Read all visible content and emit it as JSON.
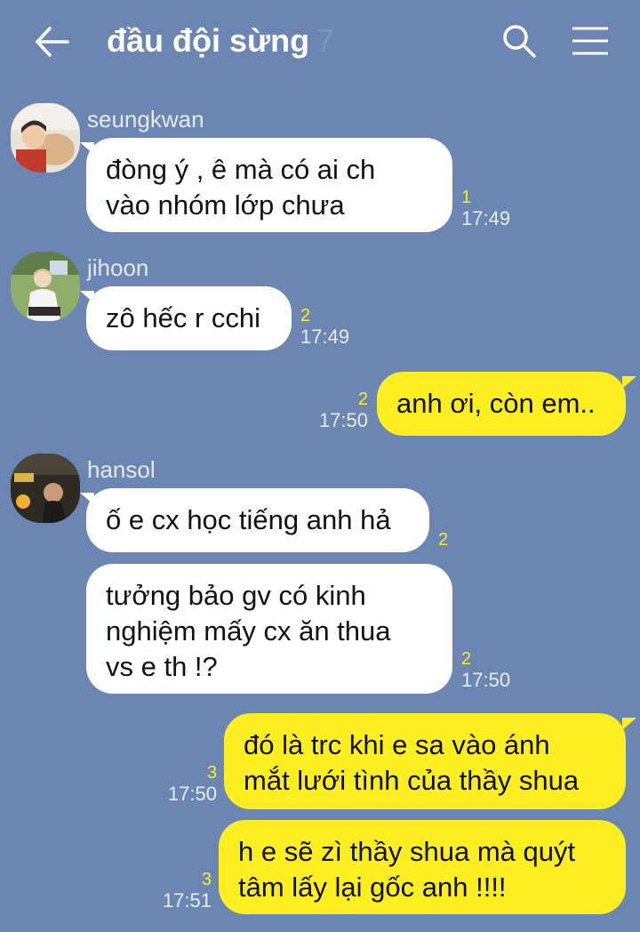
{
  "header": {
    "title": "đầu đội sừng",
    "member_count": "7",
    "back_icon": "back-arrow-icon",
    "search_icon": "search-icon",
    "menu_icon": "menu-icon"
  },
  "colors": {
    "background": "#6c86b3",
    "incoming_bubble": "#ffffff",
    "outgoing_bubble": "#fcee21",
    "unread_count": "#fcee21"
  },
  "messages": [
    {
      "sender": "seungkwan",
      "direction": "incoming",
      "text": "đòng ý , ê mà có ai ch\nvào nhóm lớp chưa",
      "unread": "1",
      "time": "17:49"
    },
    {
      "sender": "jihoon",
      "direction": "incoming",
      "text": "zô hếc r cchi",
      "unread": "2",
      "time": "17:49"
    },
    {
      "sender": "",
      "direction": "outgoing",
      "text": "anh ơi, còn em..",
      "unread": "2",
      "time": "17:50"
    },
    {
      "sender": "hansol",
      "direction": "incoming",
      "text": "ố e cx học tiếng anh hả",
      "unread": "2",
      "time": ""
    },
    {
      "sender": "",
      "direction": "incoming",
      "text": "tưởng bảo gv có kinh\nnghiệm mấy cx ăn thua\nvs e th !?",
      "unread": "2",
      "time": "17:50"
    },
    {
      "sender": "",
      "direction": "outgoing",
      "text": "đó là trc khi e sa vào ánh\nmắt lưới tình của thầy shua",
      "unread": "3",
      "time": "17:50"
    },
    {
      "sender": "",
      "direction": "outgoing",
      "text": "h e sẽ zì thầy shua mà quýt\ntâm lấy lại gốc anh !!!!",
      "unread": "3",
      "time": "17:51"
    }
  ]
}
